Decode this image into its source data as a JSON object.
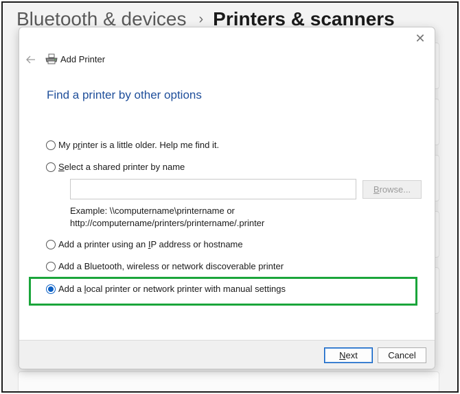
{
  "background": {
    "breadcrumb_parent": "Bluetooth & devices",
    "breadcrumb_separator": "›",
    "breadcrumb_current": "Printers & scanners"
  },
  "dialog": {
    "title": "Add Printer",
    "heading": "Find a printer by other options",
    "options": [
      {
        "pre": "My p",
        "accel": "r",
        "post": "inter is a little older. Help me find it.",
        "checked": false
      },
      {
        "pre": "",
        "accel": "S",
        "post": "elect a shared printer by name",
        "checked": false
      },
      {
        "pre": "Add a printer using an ",
        "accel": "I",
        "post": "P address or hostname",
        "checked": false
      },
      {
        "pre": "Add a Bluetooth, wireless or network discoverable printer",
        "accel": "",
        "post": "",
        "checked": false
      },
      {
        "pre": "Add a ",
        "accel": "l",
        "post": "ocal printer or network printer with manual settings",
        "checked": true
      }
    ],
    "shared_printer_input": {
      "value": "",
      "placeholder": ""
    },
    "browse_button": {
      "pre": "",
      "accel": "B",
      "post": "rowse..."
    },
    "example_line1": "Example: \\\\computername\\printername or",
    "example_line2": "http://computername/printers/printername/.printer",
    "next_button": {
      "pre": "",
      "accel": "N",
      "post": "ext"
    },
    "cancel_button": "Cancel"
  },
  "colors": {
    "heading_blue": "#1e4e9a",
    "radio_checked": "#0a5fc4",
    "highlight_green": "#1aa53a"
  },
  "icons": {
    "close": "close-icon",
    "back": "back-arrow-icon",
    "printer": "printer-icon"
  }
}
